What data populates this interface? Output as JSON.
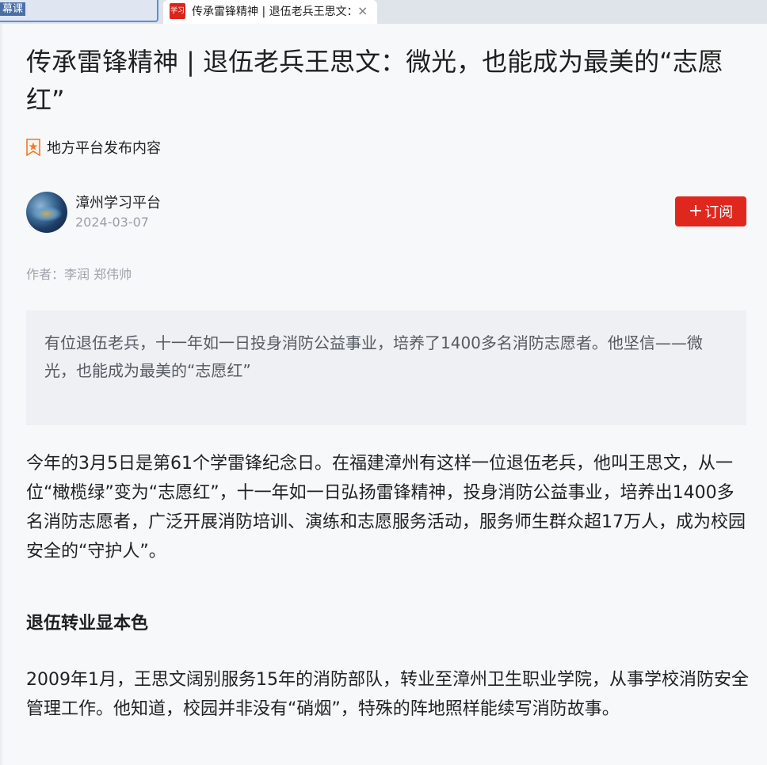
{
  "browser": {
    "prev_tab_label": "幕课",
    "active_tab_title": "传承雷锋精神 | 退伍老兵王思文：微光，也能成为最美的“志愿红”",
    "favicon_text": "学习",
    "close_glyph": "×"
  },
  "article": {
    "title": "传承雷锋精神 | 退伍老兵王思文：微光，也能成为最美的“志愿红”",
    "source_label": "地方平台发布内容",
    "publisher": {
      "name": "漳州学习平台",
      "date": "2024-03-07"
    },
    "subscribe_plus": "+",
    "subscribe_label": "订阅",
    "byline": "作者：李润 郑伟帅",
    "summary": "有位退伍老兵，十一年如一日投身消防公益事业，培养了1400多名消防志愿者。他坚信——微光，也能成为最美的“志愿红”",
    "paragraph1": "今年的3月5日是第61个学雷锋纪念日。在福建漳州有这样一位退伍老兵，他叫王思文，从一位“橄榄绿”变为“志愿红”，十一年如一日弘扬雷锋精神，投身消防公益事业，培养出1400多名消防志愿者，广泛开展消防培训、演练和志愿服务活动，服务师生群众超17万人，成为校园安全的“守护人”。",
    "section_heading": "退伍转业显本色",
    "paragraph2": "2009年1月，王思文阔别服务15年的消防部队，转业至漳州卫生职业学院，从事学校消防安全管理工作。他知道，校园并非没有“硝烟”，特殊的阵地照样能续写消防故事。"
  },
  "colors": {
    "accent_red": "#e0271e",
    "page_bg": "#f7f8fa",
    "summary_bg": "#eef0f3",
    "muted_text": "#9ea3ab"
  },
  "icons": {
    "source": "star-badge-icon",
    "close": "close-icon",
    "favicon": "xuexi-favicon-icon"
  }
}
